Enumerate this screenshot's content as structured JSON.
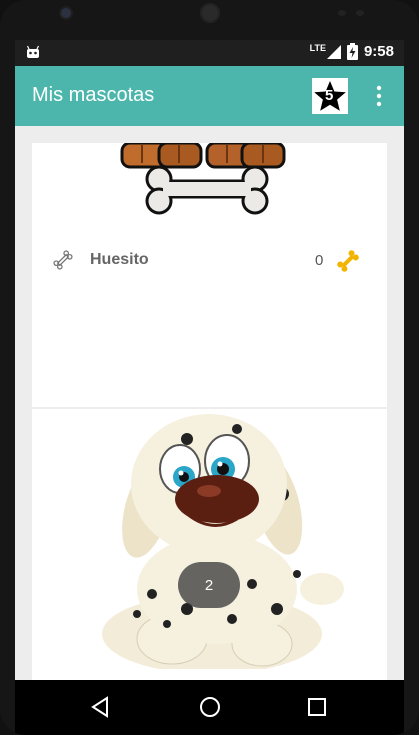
{
  "status": {
    "time": "9:58",
    "network": "LTE"
  },
  "appbar": {
    "title": "Mis mascotas",
    "star_count": "5"
  },
  "items": [
    {
      "name": "Huesito",
      "count": "0"
    }
  ],
  "fab": {
    "label": "2"
  },
  "colors": {
    "appbar": "#4db6ac",
    "status_bar": "#1f1f1f",
    "background": "#ededed"
  }
}
